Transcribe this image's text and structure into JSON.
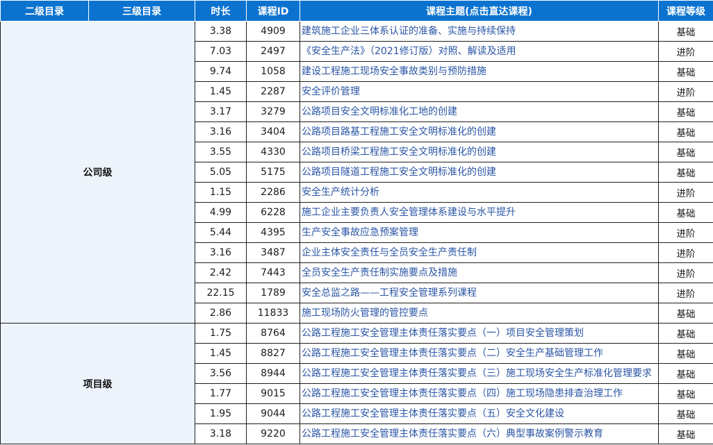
{
  "headers": {
    "level2": "二级目录",
    "level3": "三级目录",
    "duration": "时长",
    "course_id": "课程ID",
    "topic": "课程主题(点击直达课程)",
    "grade": "课程等级"
  },
  "groups": [
    {
      "label": "公司级",
      "rows": [
        {
          "duration": "3.38",
          "id": "4909",
          "topic": "建筑施工企业三体系认证的准备、实施与持续保持",
          "level": "基础"
        },
        {
          "duration": "7.03",
          "id": "2497",
          "topic": "《安全生产法》（2021修订版）对照、解读及适用",
          "level": "进阶"
        },
        {
          "duration": "9.74",
          "id": "1058",
          "topic": "建设工程施工现场安全事故类别与预防措施",
          "level": "基础"
        },
        {
          "duration": "1.45",
          "id": "2287",
          "topic": "安全评价管理",
          "level": "进阶"
        },
        {
          "duration": "3.17",
          "id": "3279",
          "topic": "公路项目安全文明标准化工地的创建",
          "level": "基础"
        },
        {
          "duration": "3.16",
          "id": "3404",
          "topic": "公路项目路基工程施工安全文明标准化的创建",
          "level": "基础"
        },
        {
          "duration": "3.55",
          "id": "4330",
          "topic": "公路项目桥梁工程施工安全文明标准化的创建",
          "level": "基础"
        },
        {
          "duration": "5.05",
          "id": "5175",
          "topic": "公路项目隧道工程施工安全文明标准化的创建",
          "level": "基础"
        },
        {
          "duration": "1.15",
          "id": "2286",
          "topic": "安全生产统计分析",
          "level": "进阶"
        },
        {
          "duration": "4.99",
          "id": "6228",
          "topic": "施工企业主要负责人安全管理体系建设与水平提升",
          "level": "基础"
        },
        {
          "duration": "5.44",
          "id": "4395",
          "topic": "生产安全事故应急预案管理",
          "level": "进阶"
        },
        {
          "duration": "3.16",
          "id": "3487",
          "topic": "企业主体安全责任与全员安全生产责任制",
          "level": "进阶"
        },
        {
          "duration": "2.42",
          "id": "7443",
          "topic": "全员安全生产责任制实施要点及措施",
          "level": "进阶"
        },
        {
          "duration": "22.15",
          "id": "1789",
          "topic": "安全总监之路——工程安全管理系列课程",
          "level": "进阶"
        },
        {
          "duration": "2.86",
          "id": "11833",
          "topic": "施工现场防火管理的管控要点",
          "level": "基础"
        }
      ]
    },
    {
      "label": "项目级",
      "rows": [
        {
          "duration": "1.75",
          "id": "8764",
          "topic": "公路工程施工安全管理主体责任落实要点（一）项目安全管理策划",
          "level": "基础"
        },
        {
          "duration": "1.45",
          "id": "8827",
          "topic": "公路工程施工安全管理主体责任落实要点（二）安全生产基础管理工作",
          "level": "基础"
        },
        {
          "duration": "3.56",
          "id": "8944",
          "topic": "公路工程施工安全管理主体责任落实要点（三）施工现场安全生产标准化管理要求",
          "level": "基础"
        },
        {
          "duration": "1.77",
          "id": "9015",
          "topic": "公路工程施工安全管理主体责任落实要点（四）施工现场隐患排查治理工作",
          "level": "基础"
        },
        {
          "duration": "1.95",
          "id": "9044",
          "topic": "公路工程施工安全管理主体责任落实要点（五）安全文化建设",
          "level": "基础"
        },
        {
          "duration": "3.18",
          "id": "9220",
          "topic": "公路工程施工安全管理主体责任落实要点（六）典型事故案例警示教育",
          "level": "基础"
        }
      ]
    }
  ]
}
